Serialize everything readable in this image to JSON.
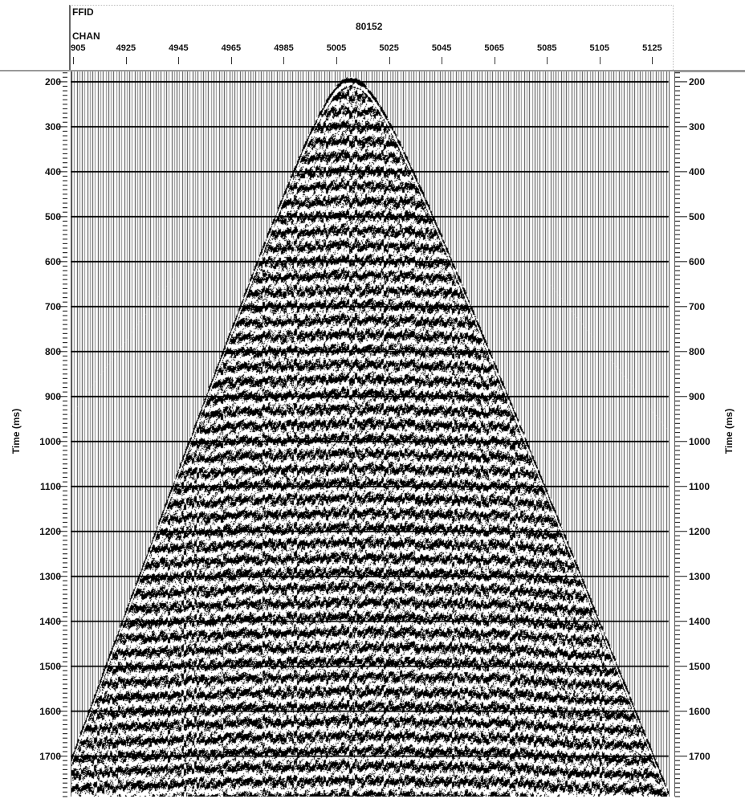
{
  "header": {
    "ffid_label": "FFID",
    "ffid_value": "80152",
    "chan_label": "CHAN"
  },
  "chart_data": {
    "type": "seismic-wiggle-gather",
    "title": "FFID 80152",
    "xlabel": "CHAN",
    "ylabel": "Time (ms)",
    "ylabel_right": "Time (ms)",
    "x_tick_labels": [
      "905",
      "4925",
      "4945",
      "4965",
      "4985",
      "5005",
      "5025",
      "5045",
      "5065",
      "5085",
      "5105",
      "5125"
    ],
    "x_tick_values": [
      4905,
      4925,
      4945,
      4965,
      4985,
      5005,
      5025,
      5045,
      5065,
      5085,
      5105,
      5125
    ],
    "xlim": [
      4904,
      5131
    ],
    "y_tick_values": [
      200,
      300,
      400,
      500,
      600,
      700,
      800,
      900,
      1000,
      1100,
      1200,
      1300,
      1400,
      1500,
      1600,
      1700
    ],
    "ylim": [
      177,
      1790
    ],
    "y_inverted": true,
    "y_minor_tick_interval": 10,
    "grid": "horizontal lines every 100 ms",
    "first_break": {
      "apex_channel": 5010,
      "apex_time_ms": 190,
      "left_edge_time_ms": 1700,
      "right_edge_time_ms": 1780
    },
    "colors": {
      "ink": "#000000",
      "background": "#ffffff",
      "trace_line": "#555555"
    }
  }
}
